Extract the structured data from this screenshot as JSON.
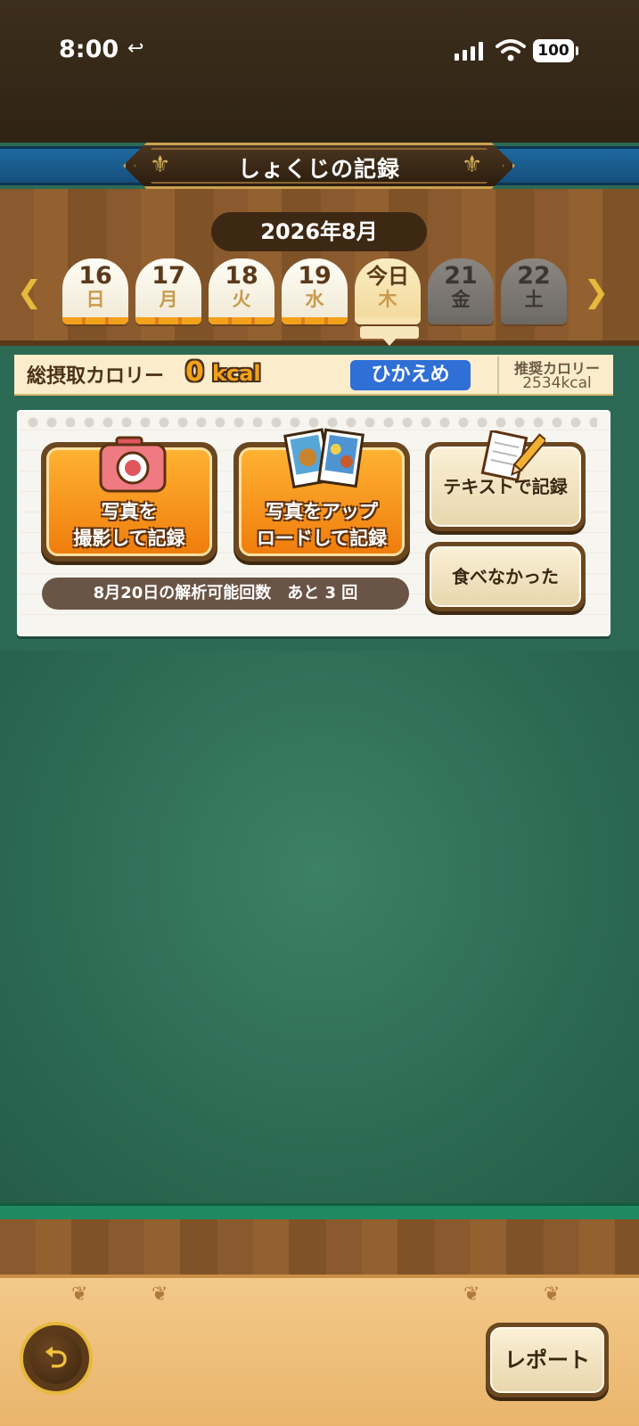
{
  "status_bar": {
    "time": "8:00",
    "back_glyph": "↩",
    "battery": "100"
  },
  "header": {
    "title": "しょくじの記録",
    "month": "2026年8月"
  },
  "week": {
    "days": [
      {
        "num": "16",
        "dow": "日"
      },
      {
        "num": "17",
        "dow": "月"
      },
      {
        "num": "18",
        "dow": "火"
      },
      {
        "num": "19",
        "dow": "水"
      },
      {
        "num": "今日",
        "dow": "木"
      },
      {
        "num": "21",
        "dow": "金"
      },
      {
        "num": "22",
        "dow": "土"
      }
    ]
  },
  "calories": {
    "label": "総摂取カロリー",
    "value": "0",
    "unit": "kcal",
    "badge": "ひかえめ",
    "recommended_label": "推奨カロリー",
    "recommended_value": "2534kcal"
  },
  "actions": {
    "photo_line1": "写真を",
    "photo_line2": "撮影して記録",
    "upload_line1": "写真をアップ",
    "upload_line2": "ロードして記録",
    "text_record": "テキストで記録",
    "not_eaten": "食べなかった",
    "remaining": "8月20日の解析可能回数　あと 3 回"
  },
  "footer": {
    "report": "レポート"
  },
  "icons": {
    "back": "back-arrow-icon",
    "prev": "chevron-left-icon",
    "next": "chevron-right-icon",
    "camera": "camera-icon",
    "photos": "photo-upload-icon",
    "memo": "memo-pencil-icon",
    "return": "return-icon"
  }
}
